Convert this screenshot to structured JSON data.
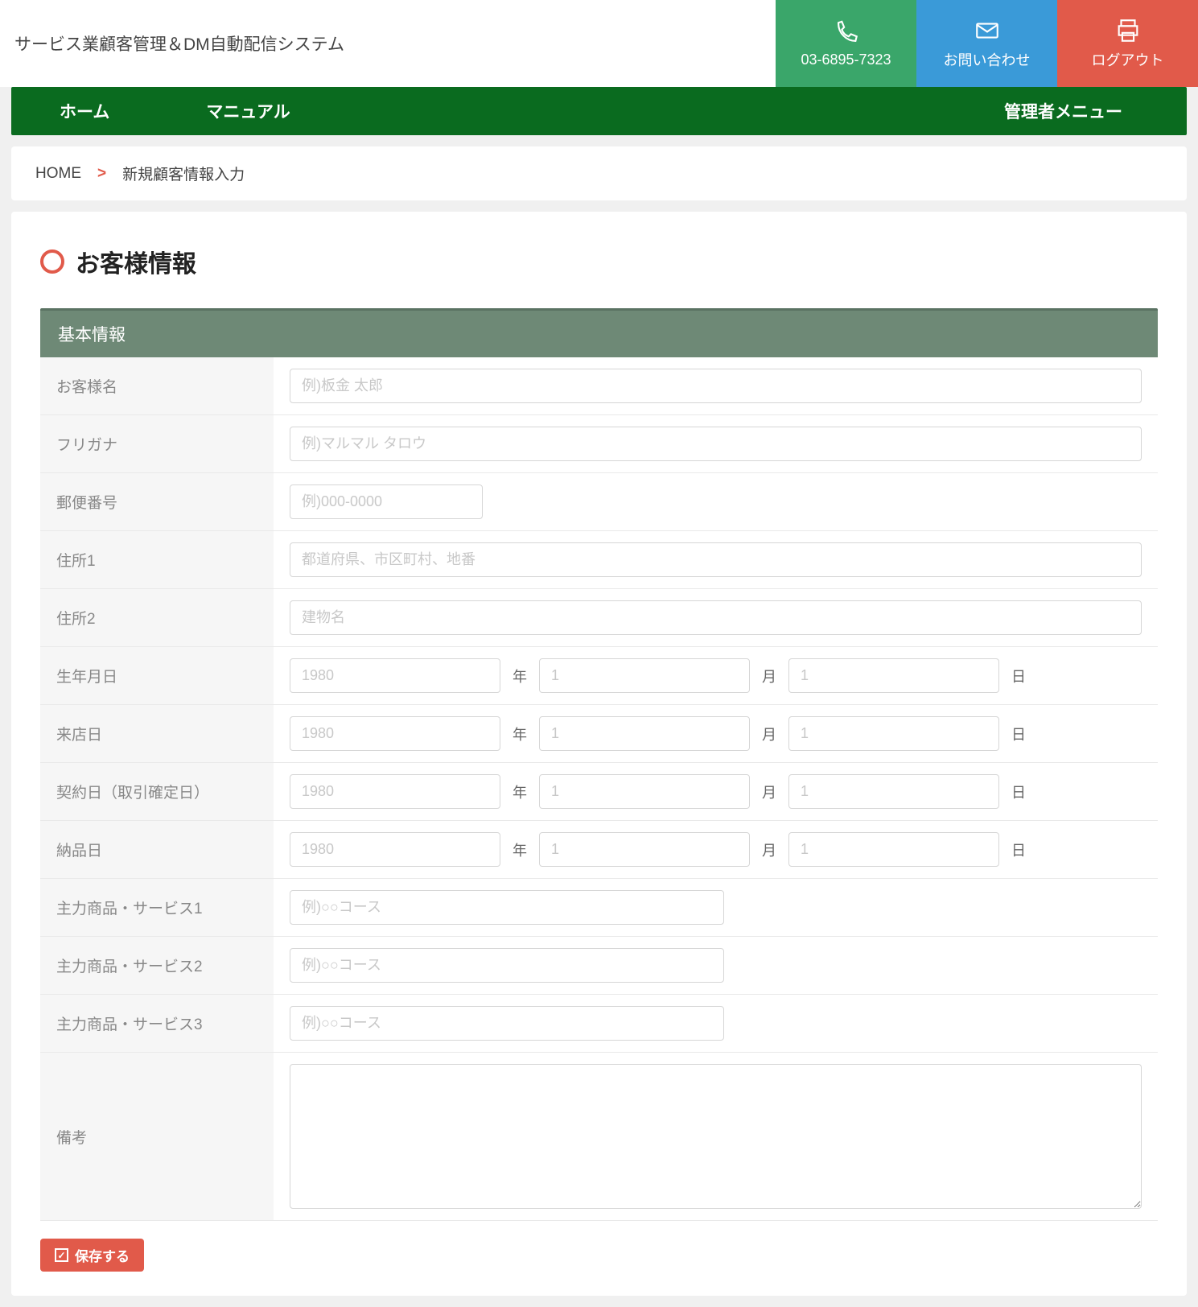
{
  "header": {
    "brand": "サービス業顧客管理＆DM自動配信システム",
    "phone": "03-6895-7323",
    "contact": "お問い合わせ",
    "logout": "ログアウト"
  },
  "nav": {
    "home": "ホーム",
    "manual": "マニュアル",
    "admin": "管理者メニュー"
  },
  "breadcrumb": {
    "home": "HOME",
    "current": "新規顧客情報入力"
  },
  "card": {
    "title": "お客様情報",
    "section": "基本情報"
  },
  "form": {
    "customerName": {
      "label": "お客様名",
      "placeholder": "例)板金 太郎"
    },
    "furigana": {
      "label": "フリガナ",
      "placeholder": "例)マルマル タロウ"
    },
    "postal": {
      "label": "郵便番号",
      "placeholder": "例)000-0000"
    },
    "address1": {
      "label": "住所1",
      "placeholder": "都道府県、市区町村、地番"
    },
    "address2": {
      "label": "住所2",
      "placeholder": "建物名"
    },
    "birth": {
      "label": "生年月日"
    },
    "visit": {
      "label": "来店日"
    },
    "contract": {
      "label": "契約日（取引確定日）"
    },
    "delivery": {
      "label": "納品日"
    },
    "product1": {
      "label": "主力商品・サービス1",
      "placeholder": "例)○○コース"
    },
    "product2": {
      "label": "主力商品・サービス2",
      "placeholder": "例)○○コース"
    },
    "product3": {
      "label": "主力商品・サービス3",
      "placeholder": "例)○○コース"
    },
    "remarks": {
      "label": "備考"
    },
    "dateUnits": {
      "year": "年",
      "month": "月",
      "day": "日"
    },
    "datePlaceholders": {
      "year": "1980",
      "month": "1",
      "day": "1"
    }
  },
  "actions": {
    "save": "保存する"
  }
}
